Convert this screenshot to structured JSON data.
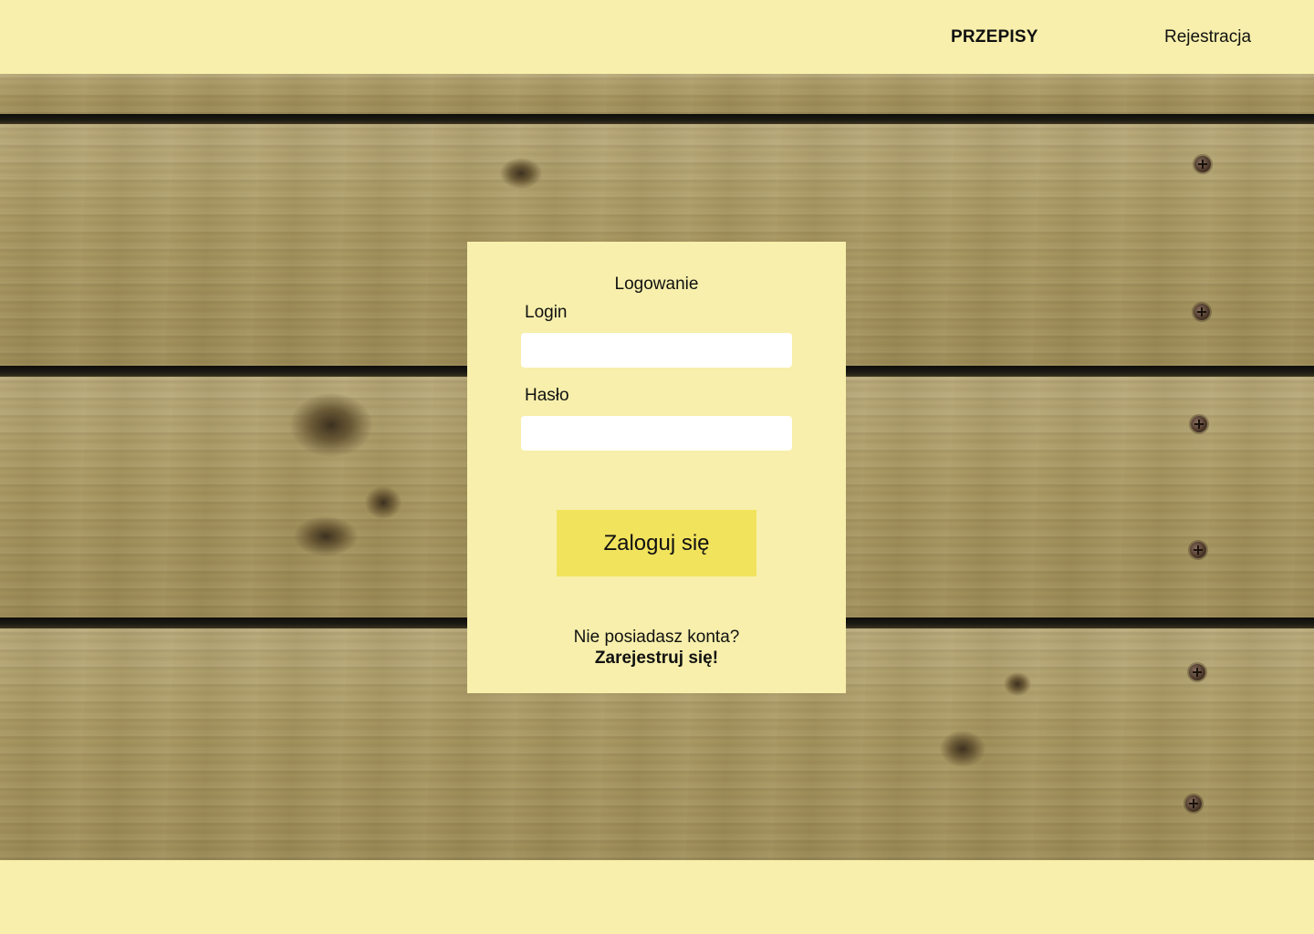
{
  "nav": {
    "brand": "PRZEPISY",
    "register": "Rejestracja"
  },
  "login": {
    "title": "Logowanie",
    "login_label": "Login",
    "login_value": "",
    "password_label": "Hasło",
    "password_value": "",
    "submit_label": "Zaloguj się",
    "no_account_text": "Nie posiadasz konta?",
    "register_link": "Zarejestruj się!"
  },
  "colors": {
    "page_background": "#f7efab",
    "button_accent": "#f2e35d",
    "input_background": "#ffffff"
  }
}
